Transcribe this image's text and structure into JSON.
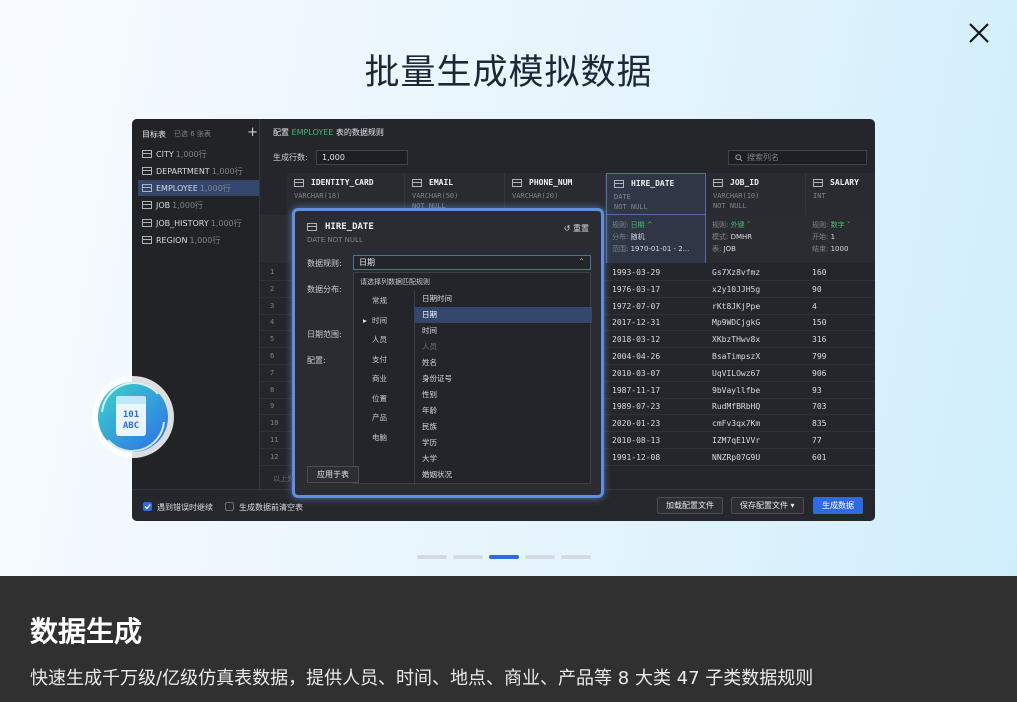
{
  "hero": {
    "title": "批量生成模拟数据"
  },
  "app": {
    "sidebar": {
      "title": "目标表",
      "selected": "已选 6 张表",
      "plus": "+",
      "tables": [
        {
          "name": "CITY",
          "count": "1,000行"
        },
        {
          "name": "DEPARTMENT",
          "count": "1,000行"
        },
        {
          "name": "EMPLOYEE",
          "count": "1,000行"
        },
        {
          "name": "JOB",
          "count": "1,000行"
        },
        {
          "name": "JOB_HISTORY",
          "count": "1,000行"
        },
        {
          "name": "REGION",
          "count": "1,000行"
        }
      ]
    },
    "config_title_prefix": "配置",
    "config_table": "EMPLOYEE",
    "config_title_suffix": "表的数据规则",
    "rows_label": "生成行数:",
    "rows_value": "1,000",
    "search_placeholder": "搜索列名",
    "columns": [
      {
        "name": "IDENTITY_CARD",
        "type": "VARCHAR(18)",
        "null": ""
      },
      {
        "name": "EMAIL",
        "type": "VARCHAR(50)",
        "null": "NOT NULL"
      },
      {
        "name": "PHONE_NUM",
        "type": "VARCHAR(20)",
        "null": ""
      },
      {
        "name": "HIRE_DATE",
        "type": "DATE",
        "null": "NOT NULL"
      },
      {
        "name": "JOB_ID",
        "type": "VARCHAR(10)",
        "null": "NOT NULL"
      },
      {
        "name": "SALARY",
        "type": "INT",
        "null": ""
      }
    ],
    "rules": {
      "hire_date": {
        "k1": "规则:",
        "v1": "日期 ^",
        "k2": "分布:",
        "v2": "随机",
        "k3": "范围:",
        "v3": "1970-01-01 - 2..."
      },
      "job_id": {
        "k1": "规则:",
        "v1": "外键 ˅",
        "k2": "模式:",
        "v2": "DMHR",
        "k3": "表:",
        "v3": "JOB"
      },
      "salary": {
        "k1": "规则:",
        "v1": "数字 ˅",
        "k2": "开始:",
        "v2": "1",
        "k3": "结束:",
        "v3": "1000"
      }
    },
    "row_numbers": [
      "1",
      "2",
      "3",
      "4",
      "5",
      "6",
      "7",
      "8",
      "9",
      "10",
      "11",
      "12"
    ],
    "hire_dates": [
      "1993-03-29",
      "1976-03-17",
      "1972-07-07",
      "2017-12-31",
      "2018-03-12",
      "2004-04-26",
      "2010-03-07",
      "1987-11-17",
      "1989-07-23",
      "2020-01-23",
      "2010-08-13",
      "1991-12-08"
    ],
    "job_ids": [
      "Gs7Xz8vfmz",
      "x2y10JJH5g",
      "rKt8JKjPpe",
      "Mp9WDCjgkG",
      "XKbzTHwv8x",
      "BsaTimpszX",
      "UqVILOwz67",
      "9bVayllfbe",
      "RudMfBRbHQ",
      "cmFv3qx7Km",
      "IZM7qE1VVr",
      "NNZRp07G9U"
    ],
    "salaries": [
      "160",
      "90",
      "4",
      "150",
      "316",
      "799",
      "906",
      "93",
      "703",
      "835",
      "77",
      "601"
    ],
    "modal": {
      "title": "HIRE_DATE",
      "subtitle": "DATE NOT NULL",
      "reset": "↺ 重置",
      "rule_label": "数据规则:",
      "rule_value": "日期",
      "dist_label": "数据分布:",
      "range_label": "日期范围:",
      "config_label": "配置:",
      "dropdown_head": "请选择列数据匹配规则",
      "categories": [
        "常规",
        "时间",
        "人员",
        "支付",
        "商业",
        "位置",
        "产品",
        "电脑"
      ],
      "options": [
        "日期时间",
        "日期",
        "时间",
        "人员",
        "姓名",
        "身份证号",
        "性别",
        "年龄",
        "民族",
        "学历",
        "大学",
        "婚姻状况"
      ],
      "apply": "应用于表",
      "hint": "以上为"
    },
    "footer": {
      "continue_label": "遇到错误时继续",
      "clear_label": "生成数据前清空表",
      "load_btn": "加载配置文件",
      "save_btn": "保存配置文件 ▾",
      "gen_btn": "生成数据"
    }
  },
  "fab_text": [
    "101",
    "ABC"
  ],
  "bottom": {
    "title": "数据生成",
    "description": "快速生成千万级/亿级仿真表数据，提供人员、时间、地点、商业、产品等 8 大类 47 子类数据规则"
  },
  "colors": {
    "accent": "#2e6ae0",
    "green": "#3fbf6a",
    "dark_panel": "#303030"
  }
}
